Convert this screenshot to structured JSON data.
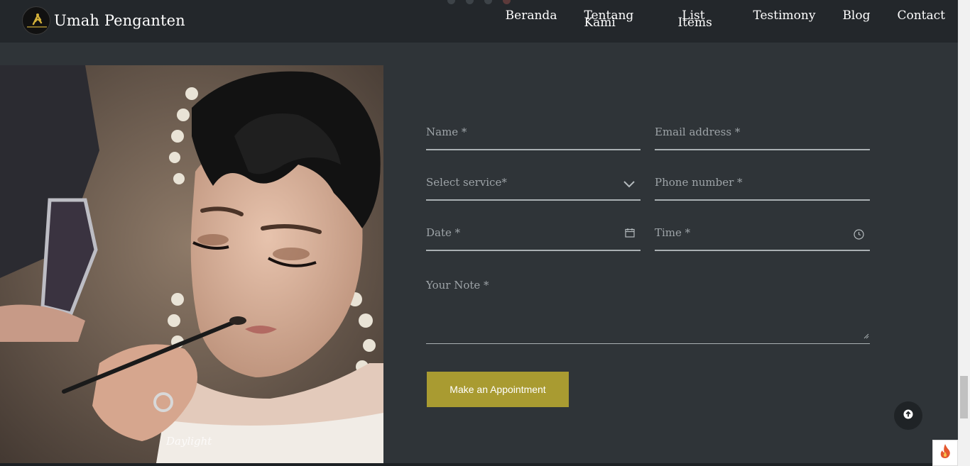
{
  "header": {
    "brand": "Umah Penganten",
    "logo_text": "UMAH PENGANTEN",
    "slider_dots": 4,
    "nav": {
      "beranda": "Beranda",
      "tentang_1": "Tentang",
      "tentang_2": "Kami",
      "list_1": "List",
      "list_2": "Items",
      "testimony": "Testimony",
      "blog": "Blog",
      "contact": "Contact"
    }
  },
  "photo": {
    "watermark": "Daylight"
  },
  "form": {
    "name_placeholder": "Name *",
    "email_placeholder": "Email address *",
    "service_placeholder": "Select service*",
    "phone_placeholder": "Phone number *",
    "date_placeholder": "Date *",
    "time_placeholder": "Time *",
    "note_placeholder": "Your Note *",
    "submit_label": "Make an Appointment"
  },
  "colors": {
    "header_bg": "#23272b",
    "page_bg": "#2f3438",
    "button_bg": "#a99b31",
    "field_line": "#aab0b3"
  },
  "icons": {
    "service": "chevron-down-icon",
    "date": "calendar-icon",
    "time": "clock-icon",
    "back_to_top": "arrow-up-circle-icon",
    "corner_widget": "fire-icon"
  }
}
